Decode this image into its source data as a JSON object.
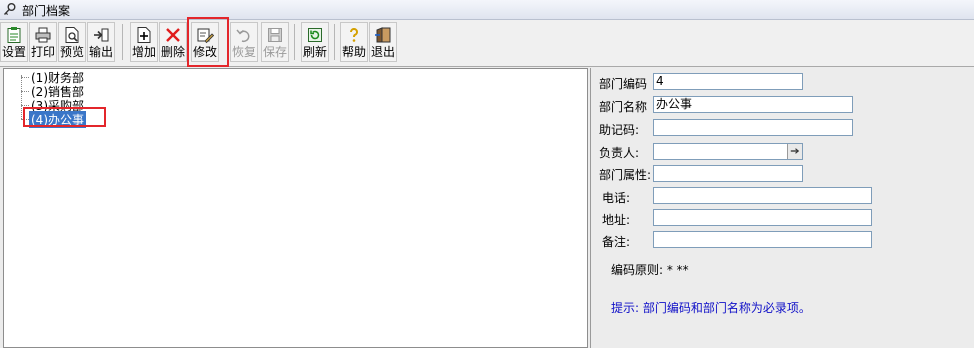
{
  "window": {
    "title": "部门档案",
    "icon": "key-icon"
  },
  "toolbar": {
    "buttons": [
      {
        "id": "setup",
        "label": "设置",
        "icon": "clipboard-icon",
        "enabled": true
      },
      {
        "id": "print",
        "label": "打印",
        "icon": "printer-icon",
        "enabled": true
      },
      {
        "id": "preview",
        "label": "预览",
        "icon": "preview-icon",
        "enabled": true
      },
      {
        "id": "export",
        "label": "输出",
        "icon": "export-icon",
        "enabled": true
      },
      {
        "id": "add",
        "label": "增加",
        "icon": "add-doc-icon",
        "enabled": true
      },
      {
        "id": "delete",
        "label": "删除",
        "icon": "red-x-icon",
        "enabled": true
      },
      {
        "id": "modify",
        "label": "修改",
        "icon": "edit-icon",
        "enabled": true,
        "highlighted": true
      },
      {
        "id": "restore",
        "label": "恢复",
        "icon": "undo-icon",
        "enabled": false
      },
      {
        "id": "save",
        "label": "保存",
        "icon": "floppy-icon",
        "enabled": false
      },
      {
        "id": "refresh",
        "label": "刷新",
        "icon": "refresh-icon",
        "enabled": true
      },
      {
        "id": "help",
        "label": "帮助",
        "icon": "help-icon",
        "enabled": true
      },
      {
        "id": "exit",
        "label": "退出",
        "icon": "exit-door-icon",
        "enabled": true
      }
    ]
  },
  "tree": {
    "items": [
      {
        "label": "(1)财务部",
        "selected": false
      },
      {
        "label": "(2)销售部",
        "selected": false
      },
      {
        "label": "(3)采购部",
        "selected": false
      },
      {
        "label": "(4)办公事",
        "selected": true
      }
    ]
  },
  "form": {
    "fields": [
      {
        "key": "code",
        "label": "部门编码",
        "value": "4"
      },
      {
        "key": "name",
        "label": "部门名称",
        "value": "办公事"
      },
      {
        "key": "mnemonic",
        "label": "助记码:",
        "value": ""
      },
      {
        "key": "manager",
        "label": "负责人:",
        "value": ""
      },
      {
        "key": "attribute",
        "label": "部门属性:",
        "value": ""
      },
      {
        "key": "phone",
        "label": "电话:",
        "value": ""
      },
      {
        "key": "address",
        "label": "地址:",
        "value": ""
      },
      {
        "key": "remark",
        "label": "备注:",
        "value": ""
      }
    ],
    "coding_rule": "编码原则: * **",
    "hint": "提示: 部门编码和部门名称为必录项。"
  },
  "colors": {
    "selection": "#3a76c8",
    "highlight_box": "#e3262b",
    "hint_text": "#1010c8"
  }
}
